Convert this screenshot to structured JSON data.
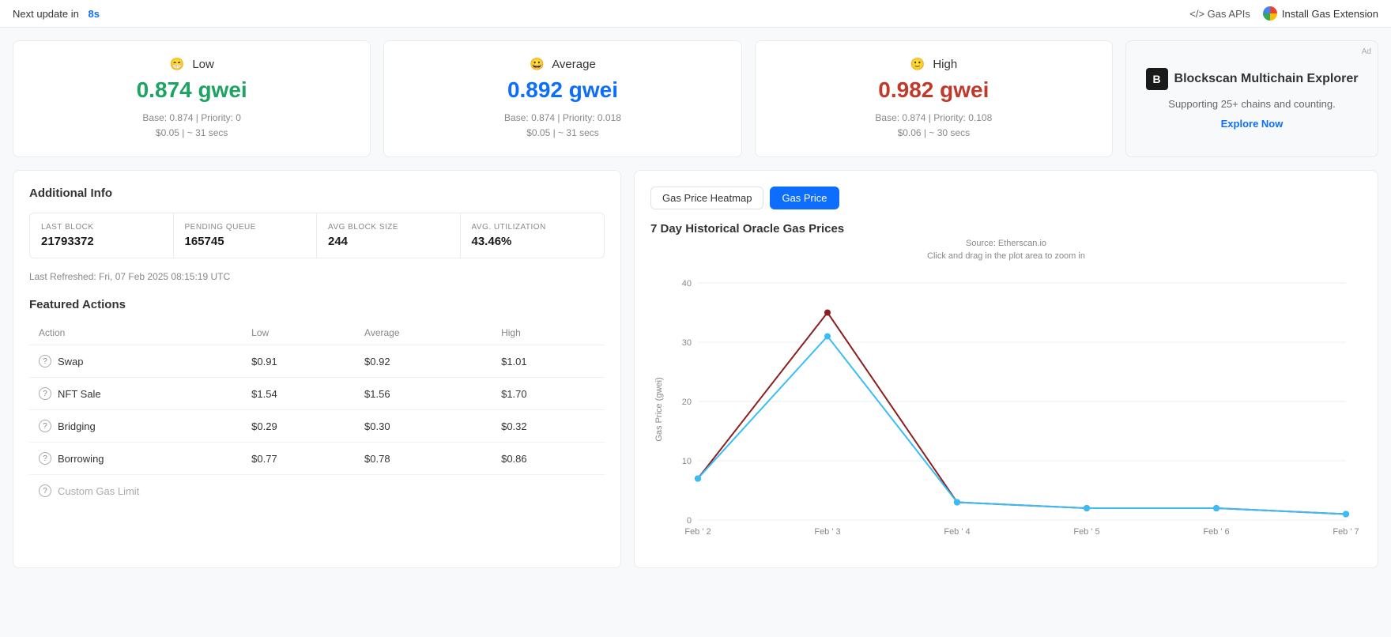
{
  "topbar": {
    "update_text": "Next update in",
    "countdown": "8s",
    "gas_apis_label": "</> Gas APIs",
    "install_ext_label": "Install Gas Extension"
  },
  "gas_cards": {
    "low": {
      "emoji": "😁",
      "label": "Low",
      "value": "0.874 gwei",
      "base": "Base: 0.874 | Priority: 0",
      "cost": "$0.05 | ~ 31 secs"
    },
    "average": {
      "emoji": "😀",
      "label": "Average",
      "value": "0.892 gwei",
      "base": "Base: 0.874 | Priority: 0.018",
      "cost": "$0.05 | ~ 31 secs"
    },
    "high": {
      "emoji": "🙂",
      "label": "High",
      "value": "0.982 gwei",
      "base": "Base: 0.874 | Priority: 0.108",
      "cost": "$0.06 | ~ 30 secs"
    },
    "ad": {
      "badge": "Ad",
      "logo_text": "Blockscan Multichain Explorer",
      "description": "Supporting 25+ chains and counting.",
      "cta": "Explore Now"
    }
  },
  "additional_info": {
    "title": "Additional Info",
    "stats": [
      {
        "label": "LAST BLOCK",
        "value": "21793372"
      },
      {
        "label": "PENDING QUEUE",
        "value": "165745"
      },
      {
        "label": "AVG BLOCK SIZE",
        "value": "244"
      },
      {
        "label": "AVG. UTILIZATION",
        "value": "43.46%"
      }
    ],
    "last_refreshed": "Last Refreshed: Fri, 07 Feb 2025 08:15:19 UTC"
  },
  "featured_actions": {
    "title": "Featured Actions",
    "columns": [
      "Action",
      "Low",
      "Average",
      "High"
    ],
    "rows": [
      {
        "name": "Swap",
        "low": "$0.91",
        "average": "$0.92",
        "high": "$1.01"
      },
      {
        "name": "NFT Sale",
        "low": "$1.54",
        "average": "$1.56",
        "high": "$1.70"
      },
      {
        "name": "Bridging",
        "low": "$0.29",
        "average": "$0.30",
        "high": "$0.32"
      },
      {
        "name": "Borrowing",
        "low": "$0.77",
        "average": "$0.78",
        "high": "$0.86"
      }
    ],
    "custom_placeholder": "Custom Gas Limit"
  },
  "chart": {
    "tabs": [
      "Gas Price Heatmap",
      "Gas Price"
    ],
    "active_tab": "Gas Price",
    "title": "7 Day Historical Oracle Gas Prices",
    "source": "Source: Etherscan.io",
    "hint": "Click and drag in the plot area to zoom in",
    "y_label": "Gas Price (gwei)",
    "x_labels": [
      "Feb ' 2",
      "Feb ' 3",
      "Feb ' 4",
      "Feb ' 5",
      "Feb ' 6",
      "Feb ' 7"
    ],
    "y_ticks": [
      0,
      10,
      20,
      30,
      40
    ],
    "series": {
      "high": {
        "color": "#8b2020",
        "points": [
          7,
          35,
          3,
          2,
          2,
          1
        ]
      },
      "average": {
        "color": "#38bdf8",
        "points": [
          7,
          31,
          3,
          2,
          2,
          1
        ]
      }
    }
  }
}
